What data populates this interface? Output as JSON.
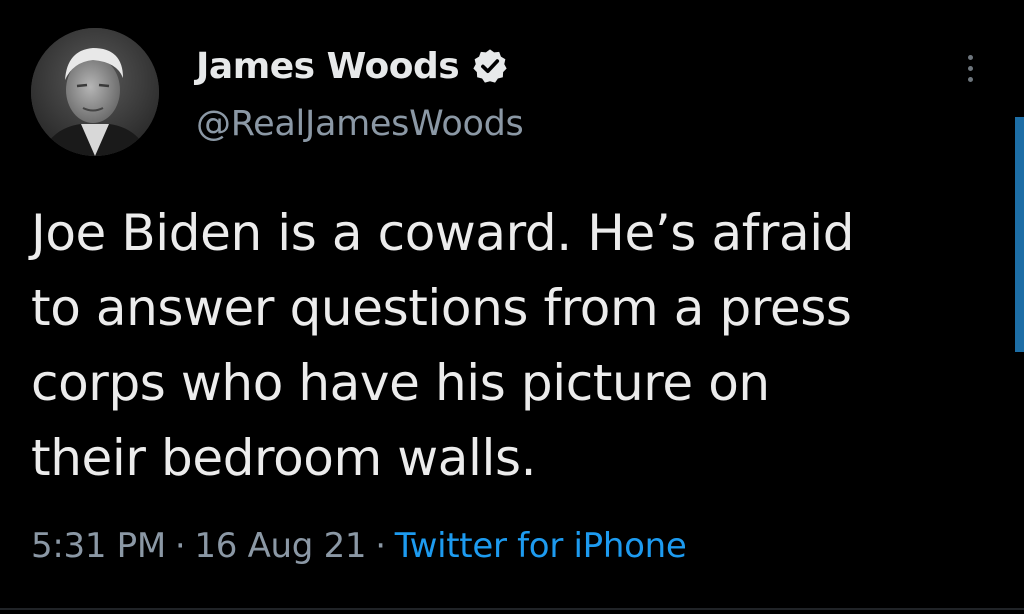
{
  "author": {
    "display_name": "James Woods",
    "handle": "@RealJamesWoods",
    "verified": true
  },
  "tweet": {
    "text": "Joe Biden is a coward. He’s afraid\nto answer questions from a press\ncorps who have his picture on\ntheir bedroom walls.",
    "time": "5:31 PM",
    "date": "16 Aug 21",
    "separator": "·",
    "source": "Twitter for iPhone"
  },
  "icons": {
    "verified": "verified-badge-icon",
    "more": "more-options-icon"
  },
  "colors": {
    "background": "#000000",
    "text": "#e7e9ea",
    "secondary": "#8b98a5",
    "accent": "#1d9bf0"
  }
}
